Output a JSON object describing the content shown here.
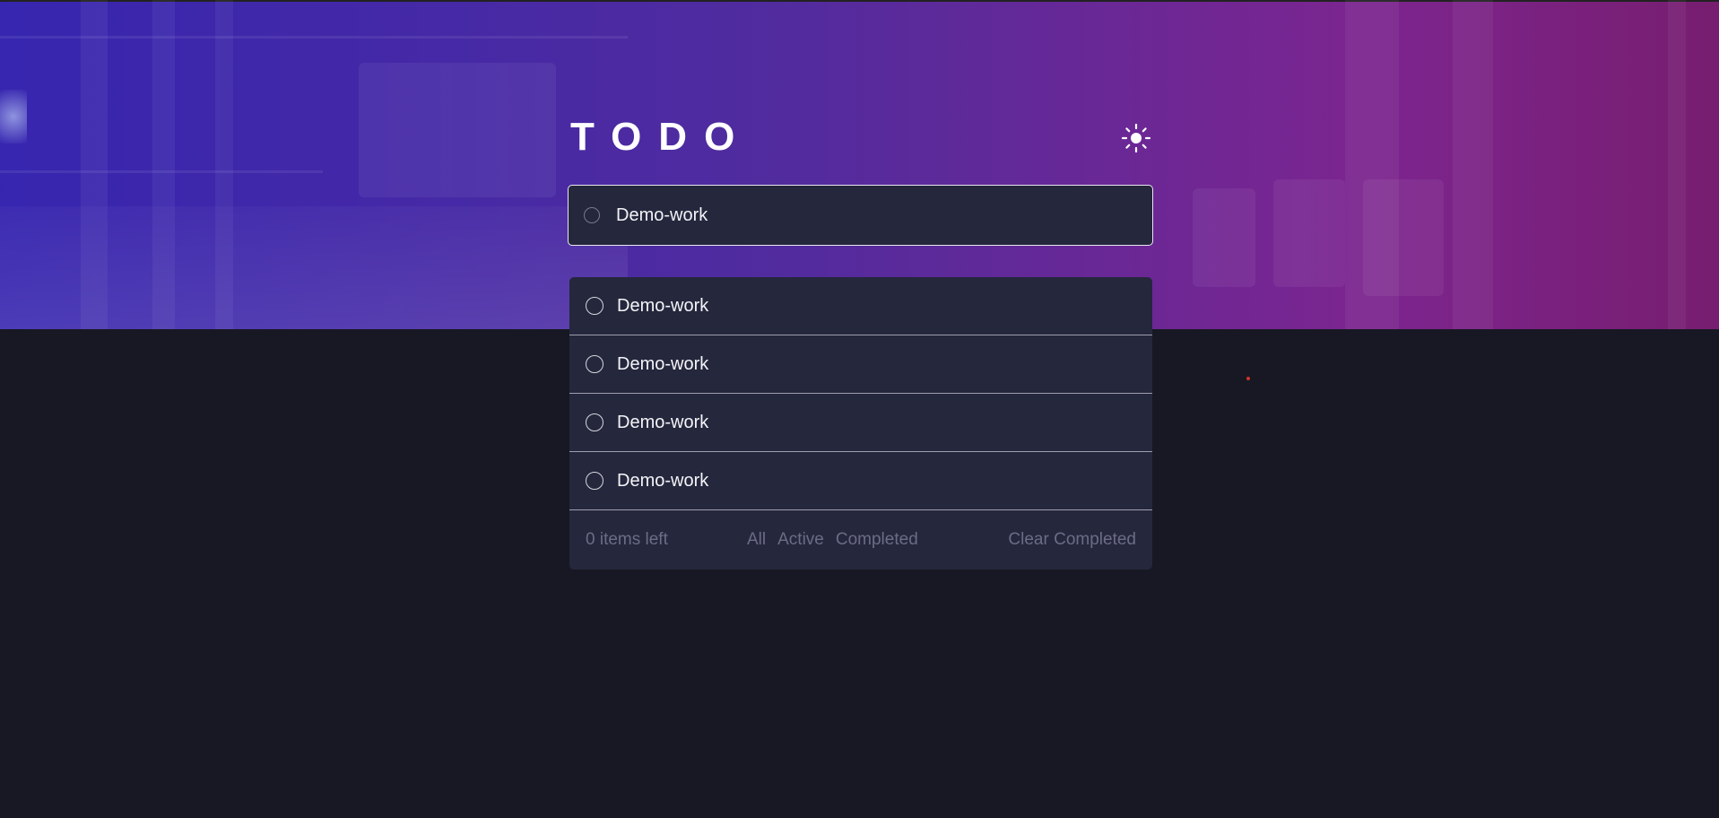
{
  "app": {
    "title": "TODO",
    "theme_icon": "sun-icon"
  },
  "new_todo": {
    "value": "Demo-work",
    "placeholder": ""
  },
  "todos": [
    {
      "text": "Demo-work"
    },
    {
      "text": "Demo-work"
    },
    {
      "text": "Demo-work"
    },
    {
      "text": "Demo-work"
    }
  ],
  "footer": {
    "items_left": "0 items left",
    "filter_all": "All",
    "filter_active": "Active",
    "filter_completed": "Completed",
    "clear_completed": "Clear Completed"
  },
  "colors": {
    "background": "#171823",
    "card": "#25273d",
    "muted_text": "#6b6c85",
    "text": "#f4f4f8",
    "gradient_start": "#3c28c8",
    "gradient_end": "#821e78"
  }
}
